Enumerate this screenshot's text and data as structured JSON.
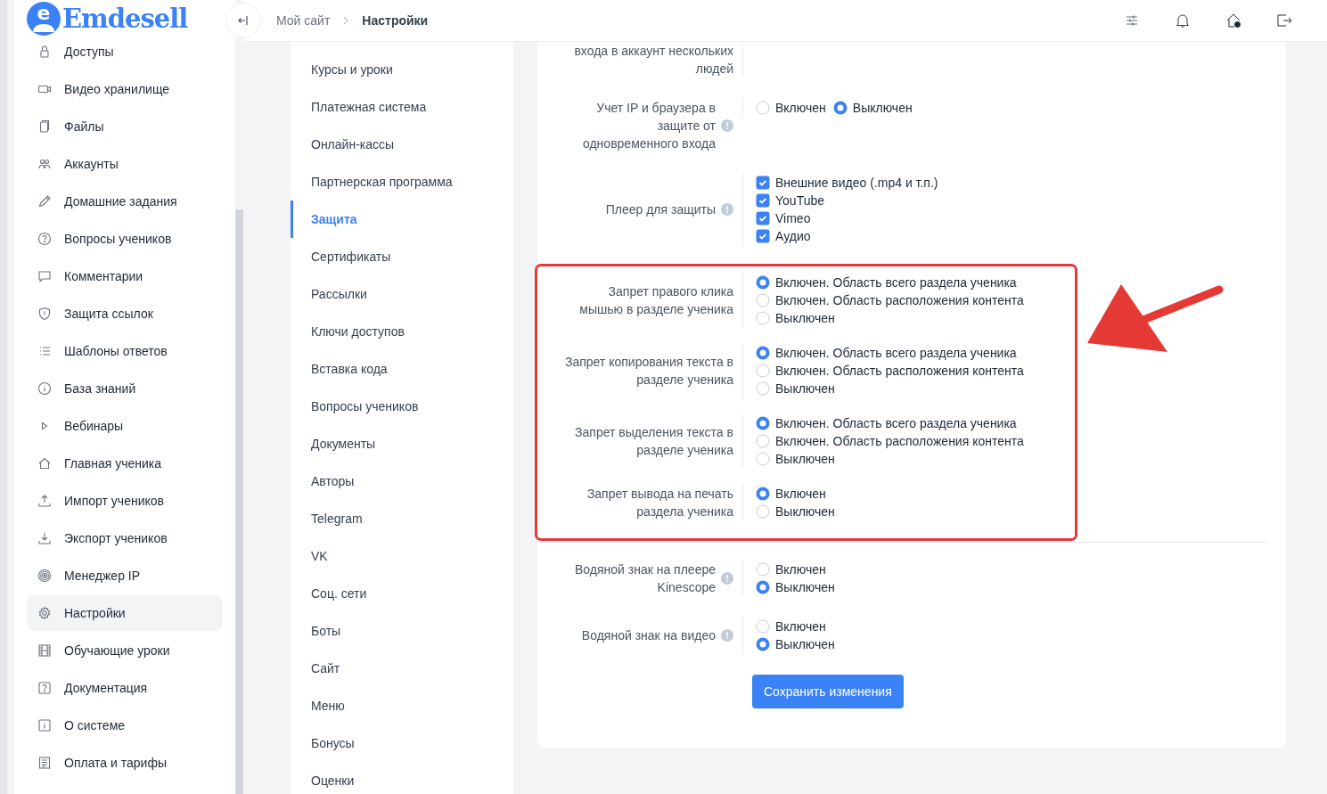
{
  "logo": {
    "mark": "e",
    "name": "Emdesell"
  },
  "sidebar": {
    "items": [
      {
        "label": "Доступы",
        "selected": false
      },
      {
        "label": "Видео хранилище",
        "selected": false
      },
      {
        "label": "Файлы",
        "selected": false
      },
      {
        "label": "Аккаунты",
        "selected": false
      },
      {
        "label": "Домашние задания",
        "selected": false
      },
      {
        "label": "Вопросы учеников",
        "selected": false
      },
      {
        "label": "Комментарии",
        "selected": false
      },
      {
        "label": "Защита ссылок",
        "selected": false
      },
      {
        "label": "Шаблоны ответов",
        "selected": false
      },
      {
        "label": "База знаний",
        "selected": false
      },
      {
        "label": "Вебинары",
        "selected": false
      },
      {
        "label": "Главная ученика",
        "selected": false
      },
      {
        "label": "Импорт учеников",
        "selected": false
      },
      {
        "label": "Экспорт учеников",
        "selected": false
      },
      {
        "label": "Менеджер IP",
        "selected": false
      },
      {
        "label": "Настройки",
        "selected": true
      },
      {
        "label": "Обучающие уроки",
        "selected": false
      },
      {
        "label": "Документация",
        "selected": false
      },
      {
        "label": "О системе",
        "selected": false
      },
      {
        "label": "Оплата и тарифы",
        "selected": false
      }
    ]
  },
  "topbar": {
    "breadcrumbs": [
      {
        "label": "Мой сайт",
        "current": false
      },
      {
        "label": "Настройки",
        "current": true
      }
    ]
  },
  "settings_nav": {
    "items": [
      {
        "label": "Курсы и уроки",
        "selected": false
      },
      {
        "label": "Платежная система",
        "selected": false
      },
      {
        "label": "Онлайн-кассы",
        "selected": false
      },
      {
        "label": "Партнерская программа",
        "selected": false
      },
      {
        "label": "Защита",
        "selected": true
      },
      {
        "label": "Сертификаты",
        "selected": false
      },
      {
        "label": "Рассылки",
        "selected": false
      },
      {
        "label": "Ключи доступов",
        "selected": false
      },
      {
        "label": "Вставка кода",
        "selected": false
      },
      {
        "label": "Вопросы учеников",
        "selected": false
      },
      {
        "label": "Документы",
        "selected": false
      },
      {
        "label": "Авторы",
        "selected": false
      },
      {
        "label": "Telegram",
        "selected": false
      },
      {
        "label": "VK",
        "selected": false
      },
      {
        "label": "Соц. сети",
        "selected": false
      },
      {
        "label": "Боты",
        "selected": false
      },
      {
        "label": "Сайт",
        "selected": false
      },
      {
        "label": "Меню",
        "selected": false
      },
      {
        "label": "Бонусы",
        "selected": false
      },
      {
        "label": "Оценки",
        "selected": false
      }
    ]
  },
  "settings": [
    {
      "label": "входа в аккаунт нескольких людей",
      "info": false,
      "kind": "radio_list",
      "highlighted": false
    },
    {
      "label": "Учет IP и браузера в защите от одновременного входа",
      "info": true,
      "kind": "radio_row",
      "highlighted": false,
      "options": [
        {
          "label": "Включен",
          "selected": false
        },
        {
          "label": "Выключен",
          "selected": true
        }
      ]
    },
    {
      "label": "Плеер для защиты",
      "info": true,
      "kind": "checkbox_list",
      "highlighted": false,
      "options": [
        {
          "label": "Внешние видео (.mp4 и т.п.)",
          "checked": true
        },
        {
          "label": "YouTube",
          "checked": true
        },
        {
          "label": "Vimeo",
          "checked": true
        },
        {
          "label": "Аудио",
          "checked": true
        }
      ]
    },
    {
      "label": "Запрет правого клика мышью в разделе ученика",
      "info": false,
      "kind": "radio_list",
      "highlighted": true,
      "options": [
        {
          "label": "Включен. Область всего раздела ученика",
          "selected": true
        },
        {
          "label": "Включен. Область расположения контента",
          "selected": false
        },
        {
          "label": "Выключен",
          "selected": false
        }
      ]
    },
    {
      "label": "Запрет копирования текста в разделе ученика",
      "info": false,
      "kind": "radio_list",
      "highlighted": true,
      "options": [
        {
          "label": "Включен. Область всего раздела ученика",
          "selected": true
        },
        {
          "label": "Включен. Область расположения контента",
          "selected": false
        },
        {
          "label": "Выключен",
          "selected": false
        }
      ]
    },
    {
      "label": "Запрет выделения текста в разделе ученика",
      "info": false,
      "kind": "radio_list",
      "highlighted": true,
      "options": [
        {
          "label": "Включен. Область всего раздела ученика",
          "selected": true
        },
        {
          "label": "Включен. Область расположения контента",
          "selected": false
        },
        {
          "label": "Выключен",
          "selected": false
        }
      ]
    },
    {
      "label": "Запрет вывода на печать раздела ученика",
      "info": false,
      "kind": "radio_list",
      "highlighted": true,
      "options": [
        {
          "label": "Включен",
          "selected": true
        },
        {
          "label": "Выключен",
          "selected": false
        }
      ]
    },
    {
      "label": "Водяной знак на плеере Kinescope",
      "info": true,
      "kind": "radio_list",
      "highlighted": false,
      "options": [
        {
          "label": "Включен",
          "selected": false
        },
        {
          "label": "Выключен",
          "selected": true
        }
      ]
    },
    {
      "label": "Водяной знак на видео",
      "info": true,
      "kind": "radio_list",
      "highlighted": false,
      "options": [
        {
          "label": "Включен",
          "selected": false
        },
        {
          "label": "Выключен",
          "selected": true
        }
      ]
    }
  ],
  "save_button": "Сохранить изменения"
}
